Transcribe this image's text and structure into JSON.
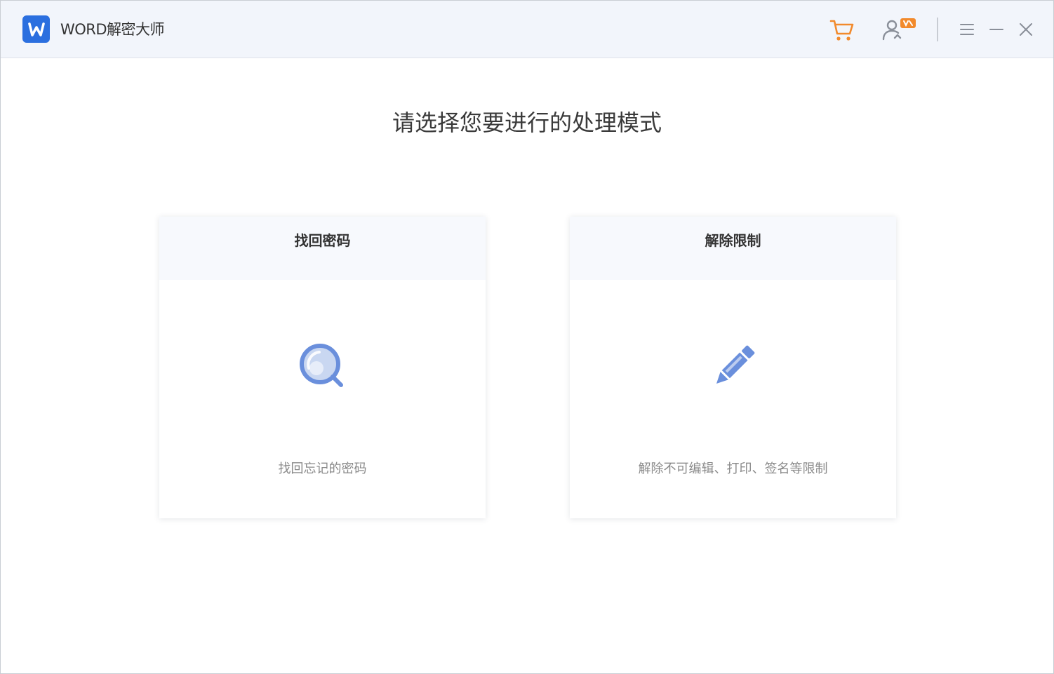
{
  "app": {
    "title": "WORD解密大师",
    "logo_icon": "word-logo-icon",
    "accent_color": "#2b6fdf"
  },
  "titlebar": {
    "cart_icon": "shopping-cart-icon",
    "cart_color": "#f28a2c",
    "user_icon": "user-account-icon",
    "user_badge_color": "#f28a2c",
    "menu_icon": "menu-icon",
    "minimize_icon": "minimize-icon",
    "close_icon": "close-icon"
  },
  "main": {
    "heading": "请选择您要进行的处理模式",
    "cards": [
      {
        "title": "找回密码",
        "icon": "magnifier-icon",
        "description": "找回忘记的密码"
      },
      {
        "title": "解除限制",
        "icon": "pencil-icon",
        "description": "解除不可编辑、打印、签名等限制"
      }
    ]
  }
}
